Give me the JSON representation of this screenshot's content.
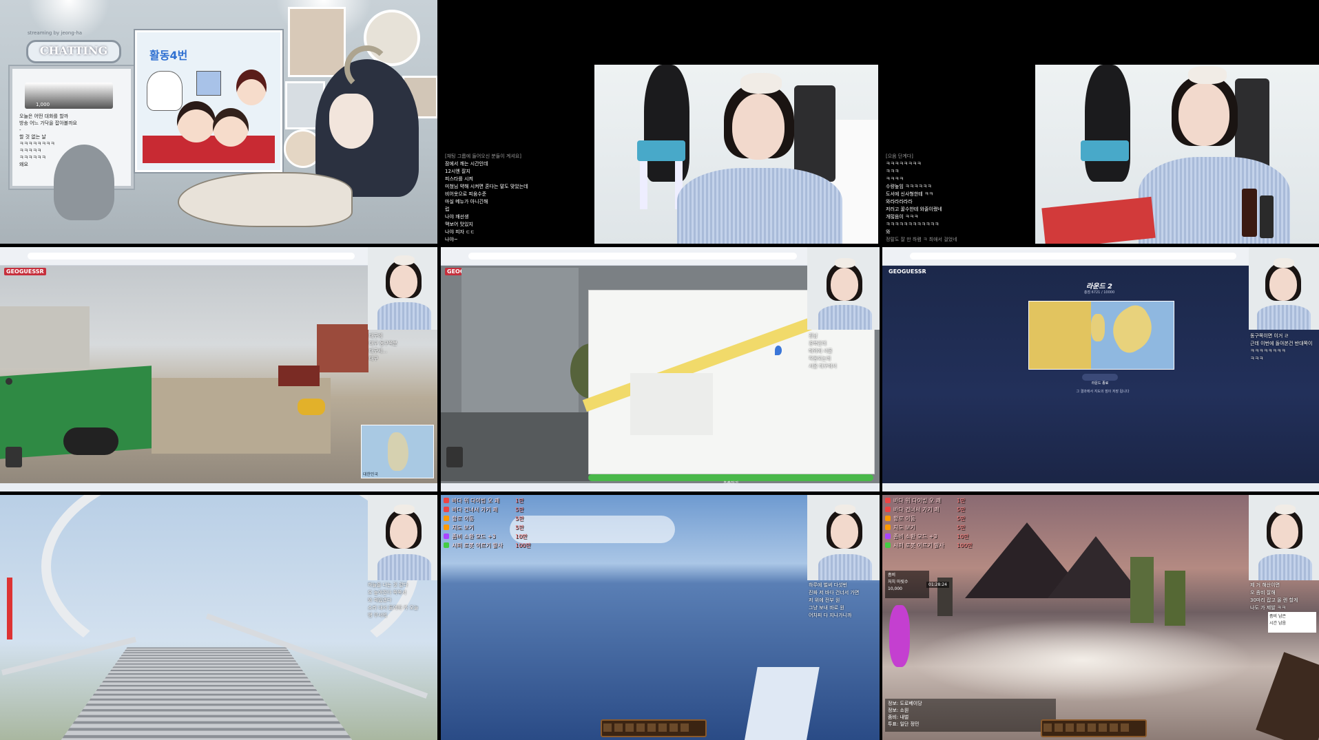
{
  "tiles": {
    "t1": {
      "chatting_sign": "CHATTING",
      "sign_caption": "streaming by jeong-ha",
      "coin_amount": "1,000",
      "poster_title": "활동4번",
      "chat": [
        "오늘은 어떤 대화를 할까",
        "방송 어느 가닥을 잡아볼까요",
        "-",
        "할 것 없는 날",
        "ㅋㅋㅋㅋㅋㅋㅋㅋ",
        "ㅋㅋㅋㅋㅋ",
        "ㅋㅋㅋㅋㅋㅋ",
        "왜요"
      ]
    },
    "t2": {
      "chat_faint": "[채팅 그룹에 들어오신 분들이 계셔요]",
      "chat": [
        "잠에서 깨는 시간인데",
        "12시엔 잘지",
        "피스타를 시켜",
        "미쳤님 약해 시켜면 혼다는 말도 맞았는데",
        "비어옷으로 피움수준",
        "마실 메뉴가 아니긴해",
        "럽",
        "나야 깨선생",
        "맥보어 맛있지",
        "나야 피자 ㄷㄷ",
        "나야~"
      ]
    },
    "t3": {
      "chat_faint": "[으음 단계다]",
      "chat": [
        "ㅋㅋㅋㅋㅋㅋㅋㅋ",
        "ㅋㅋㅋ",
        "ㅋㅋㅋㅋ",
        "수량높임 ㅋㅋㅋㅋㅋㅋ",
        "도서에 신사형한테 ㅋㅋ",
        "와라라라라라",
        "저러고 꿀수한테 와줄이랬네",
        "개많음이 ㅋㅋㅋ",
        "ㅋㅋㅋㅋㅋㅋㅋㅋㅋㅋㅋㅋ",
        "와"
      ],
      "chat_faint_bottom": "정말도 잘 만 하렴 ㅋ 최애서 걸었네"
    },
    "t4": {
      "logo": "GEOGUESSR",
      "chat": [
        "대구에",
        "대구 동구쪽분",
        "대구세...",
        "대구"
      ],
      "minimap_label": "대한민국"
    },
    "t5": {
      "logo": "GEOGUESSR",
      "chat": [
        "경남",
        "경북인데",
        "해외에 서울",
        "작동되는데",
        "서울 대구에서"
      ],
      "guess_button": "추측하기"
    },
    "t6": {
      "logo": "GEOGUESSR",
      "round_title": "라운드 2",
      "round_sub": "총점 6721 / 10000",
      "next_button": "라운드 종료",
      "notice": "그 결과에서 지도의 점이 저장 됩니다",
      "chat": [
        "동구쪽이면 이거 ㄹ",
        "근데 이번에 돌아본건 반대쪽이",
        "ㅋㅋㅋㅋㅋㅋㅋㅋ",
        "ㅋㅋㅋ"
      ]
    },
    "t7": {
      "chat": [
        "하늘을 나는 것 같다",
        "오 높아진다 쪽쪽서",
        "와 재밌겠다",
        "소리 내서 들어봐 카 오늘",
        "앵 무서워"
      ]
    },
    "t8": {
      "donations": [
        {
          "label": "바다 위 다이빙 오 쾌",
          "value": "1만"
        },
        {
          "label": "바다 건너서 가기 쾌",
          "value": "5만"
        },
        {
          "label": "항로 이동",
          "value": "5만"
        },
        {
          "label": "지도 보기",
          "value": "5만"
        },
        {
          "label": "좀비 소환 모드 +3",
          "value": "10만"
        },
        {
          "label": "시퍼 로봇 이르기 발사",
          "value": "100만"
        }
      ],
      "chat": [
        "하루에 벌써 다섯번",
        "진짜 저 바다 건너서 가면",
        "저 위에 전부 원",
        "그냥 보내 바로 원",
        "어차피 다 지나가니까"
      ]
    },
    "t9": {
      "donations": [
        {
          "label": "바다 위 다이빙 오 쾌",
          "value": "1만"
        },
        {
          "label": "바다 건너서 가기 쾌",
          "value": "5만"
        },
        {
          "label": "항로 이동",
          "value": "5만"
        },
        {
          "label": "지도 보기",
          "value": "5만"
        },
        {
          "label": "좀비 소환 모드 +3",
          "value": "10만"
        },
        {
          "label": "시퍼 로봇 이르기 발사",
          "value": "100만"
        }
      ],
      "stat_box": [
        "좀비",
        "처치 마릿수",
        "10,000"
      ],
      "timer": "01:28:24",
      "chat": [
        "제 거 해산이면",
        "오 좀비 잘해",
        "30마리 잡고 올 렌 할게",
        "나도 가 제발 ㅋㅋ"
      ],
      "side_panel": [
        "좀비 남은",
        "시간 남음"
      ],
      "game_chat": [
        "정보: 도로베이당",
        "정보: 소원",
        "좀비: 내벌",
        "투표: 일단 정민"
      ]
    }
  }
}
